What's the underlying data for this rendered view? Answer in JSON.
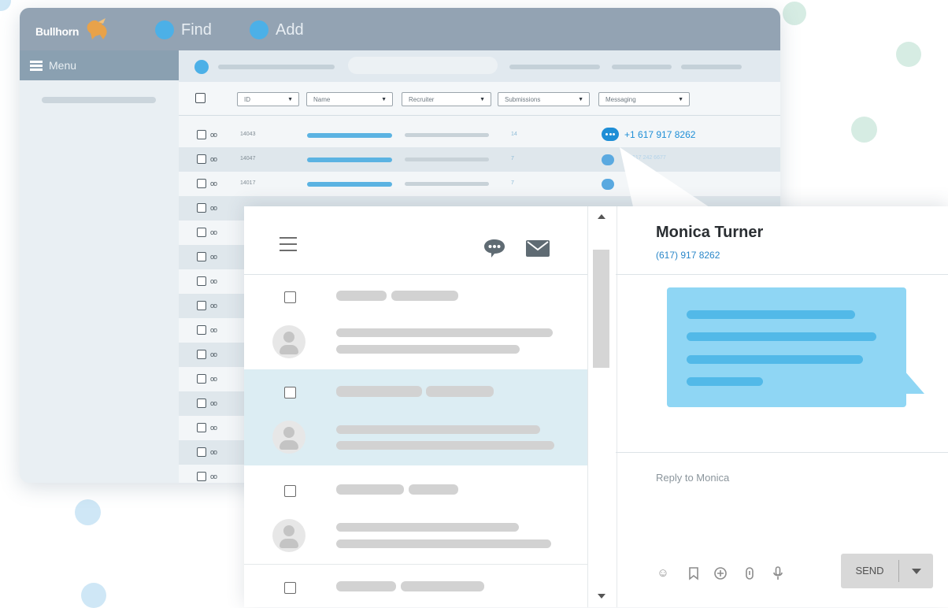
{
  "colors": {
    "accent": "#4cb0e7",
    "topbar": "#93a3b3",
    "chat_blue": "#1e8ed6",
    "bubble": "#8fd6f4",
    "selected_row": "#dcedf3"
  },
  "app": {
    "logo": "Bullhorn",
    "find_label": "Find",
    "add_label": "Add",
    "menu_label": "Menu"
  },
  "table": {
    "filters": [
      {
        "label": "ID"
      },
      {
        "label": "Name"
      },
      {
        "label": "Recruiter"
      },
      {
        "label": "Submissions"
      },
      {
        "label": "Messaging"
      }
    ],
    "rows": [
      {
        "id": "14043",
        "submissions": "14",
        "phone": "+1 617 917 8262"
      },
      {
        "id": "14047",
        "submissions": "7",
        "phone": "+1 617 242 6677"
      },
      {
        "id": "14017",
        "submissions": "7",
        "phone": ""
      }
    ],
    "icon_names": [
      "checkbox",
      "binoculars-icon",
      "chat-icon"
    ]
  },
  "messenger": {
    "icon_names": [
      "hamburger-menu-icon",
      "chat-bubble-icon",
      "envelope-icon",
      "scroll-up-arrow",
      "scroll-down-arrow"
    ],
    "contact_name": "Monica Turner",
    "contact_phone": "(617) 917 8262",
    "reply_placeholder": "Reply to Monica",
    "send_label": "SEND",
    "toolbar_icons": [
      "smiley-icon",
      "bookmark-icon",
      "add-circle-icon",
      "attachment-icon",
      "microphone-icon"
    ]
  }
}
